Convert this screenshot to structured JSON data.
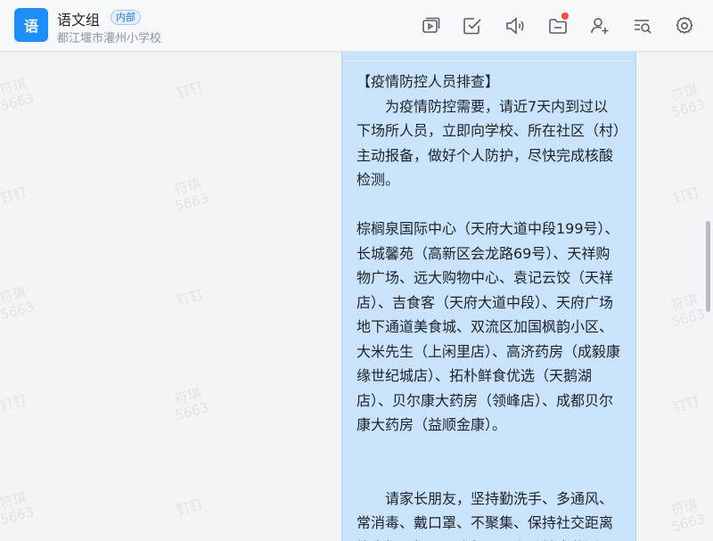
{
  "header": {
    "avatar_char": "语",
    "group_name": "语文组",
    "badge": "内部",
    "school": "都江堰市灌州小学校"
  },
  "toolbar": {
    "icons": [
      "video-meeting-icon",
      "task-check-icon",
      "announcement-icon",
      "files-icon",
      "add-member-icon",
      "search-history-icon",
      "settings-icon"
    ],
    "files_has_unread": true
  },
  "watermark": {
    "line1": "符琪",
    "line2": "5663",
    "line_alt": "钉钉"
  },
  "message": {
    "title": "【疫情防控人员排查】",
    "para1": "为疫情防控需要，请近7天内到过以下场所人员，立即向学校、所在社区（村）主动报备，做好个人防护，尽快完成核酸检测。",
    "para2": "棕榈泉国际中心（天府大道中段199号）、长城馨苑（高新区会龙路69号）、天祥购物广场、远大购物中心、袁记云饺（天祥店）、吉食客（天府大道中段）、天府广场地下通道美食城、双流区加国枫韵小区、大米先生（上闲里店）、高济药房（成毅康缘世纪城店）、拓朴鲜食优选（天鹅湖店）、贝尔康大药房（领峰店）、成都贝尔康大药房（益顺金康）。",
    "para3": "请家长朋友，坚持勤洗手、多通风、常消毒、戴口罩、不聚集、保持社交距离等良好习惯，配合相互，主动健康监测"
  },
  "colors": {
    "accent": "#1e8efc",
    "message_bg": "#c9e3fb",
    "badge_text": "#1e7cf2",
    "unread_dot": "#f54a45"
  }
}
